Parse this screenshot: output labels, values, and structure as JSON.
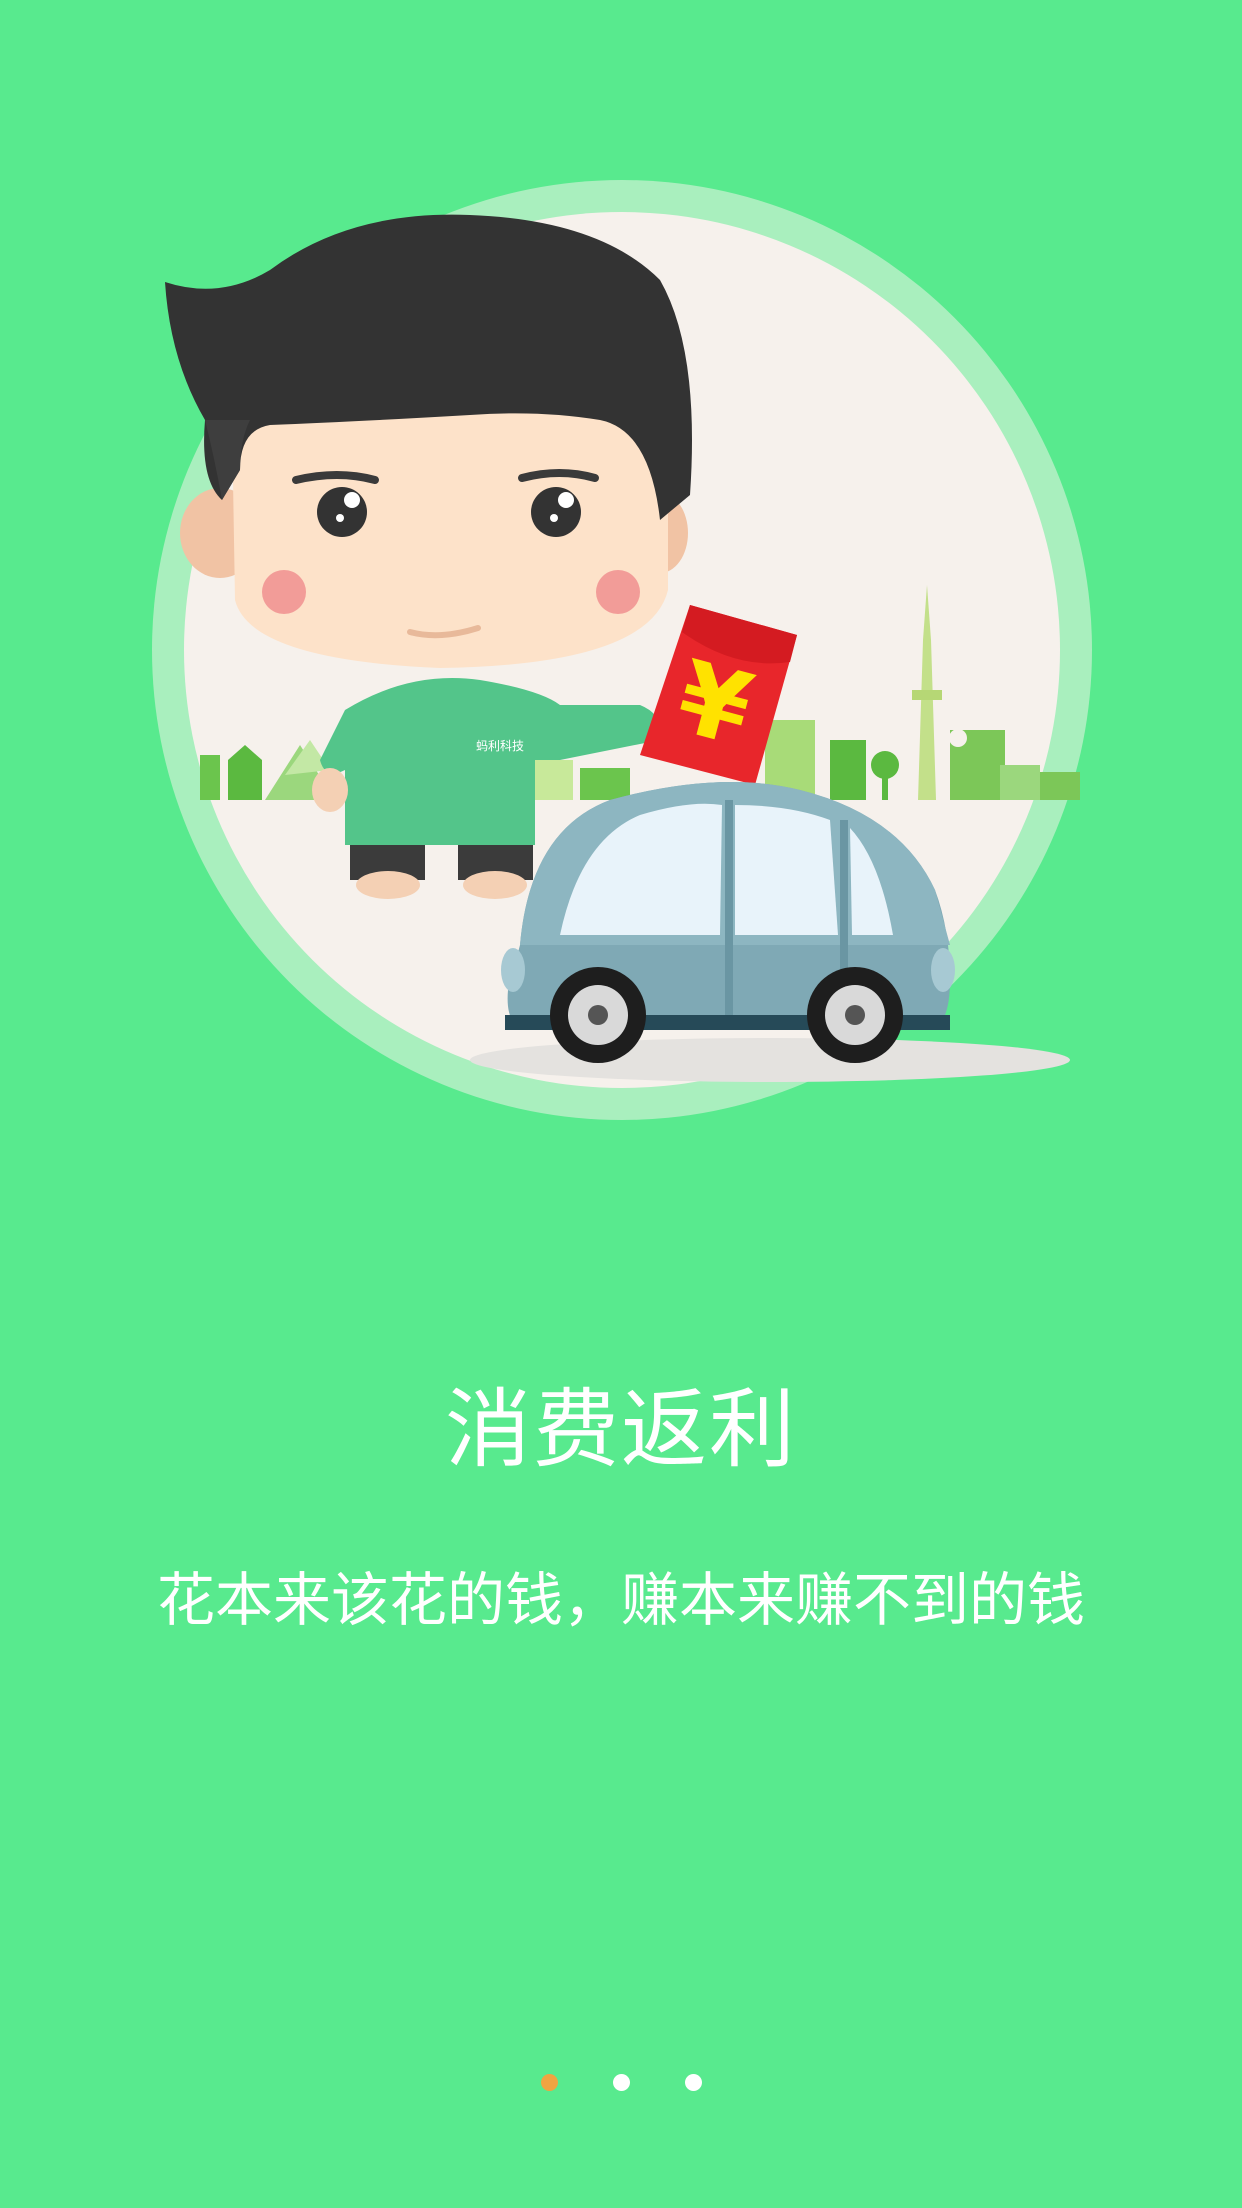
{
  "onboarding": {
    "title": "消费返利",
    "subtitle": "花本来该花的钱，赚本来赚不到的钱",
    "shirt_logo": "蚂利科技",
    "currency_symbol": "¥"
  },
  "pager": {
    "count": 3,
    "active_index": 0
  },
  "colors": {
    "background": "#58EA8E",
    "text": "#FFFFFF",
    "active_dot": "#F0A441",
    "inactive_dot": "#FFFFFF"
  }
}
